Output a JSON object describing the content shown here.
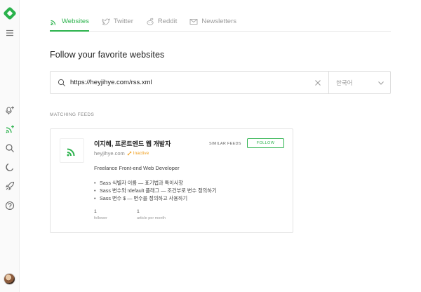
{
  "tabs": [
    {
      "label": "Websites",
      "icon": "rss-icon",
      "active": true
    },
    {
      "label": "Twitter",
      "icon": "twitter-icon",
      "active": false
    },
    {
      "label": "Reddit",
      "icon": "reddit-icon",
      "active": false
    },
    {
      "label": "Newsletters",
      "icon": "mail-icon",
      "active": false
    }
  ],
  "page": {
    "title": "Follow your favorite websites"
  },
  "search": {
    "value": "https://heyjihye.com/rss.xml",
    "language": "한국어"
  },
  "results": {
    "label": "MATCHING FEEDS"
  },
  "feed": {
    "title": "이지혜, 프론트엔드 웹 개발자",
    "domain": "heyjihye.com",
    "status": "Inactive",
    "similar_label": "SIMILAR FEEDS",
    "follow_label": "FOLLOW",
    "description": "Freelance Front-end Web Developer",
    "items": [
      "Sass 식별자 이름 — 표기법과 특이사항",
      "Sass 변수와 !default 플래그 — 조건부로 변수 정의하기",
      "Sass 변수 $ — 변수를 정의하고 사용하기"
    ],
    "stats": [
      {
        "value": "1",
        "label": "follower"
      },
      {
        "value": "1",
        "label": "article per month"
      }
    ]
  },
  "colors": {
    "accent": "#2bb24c",
    "inactive": "#f0a020"
  }
}
